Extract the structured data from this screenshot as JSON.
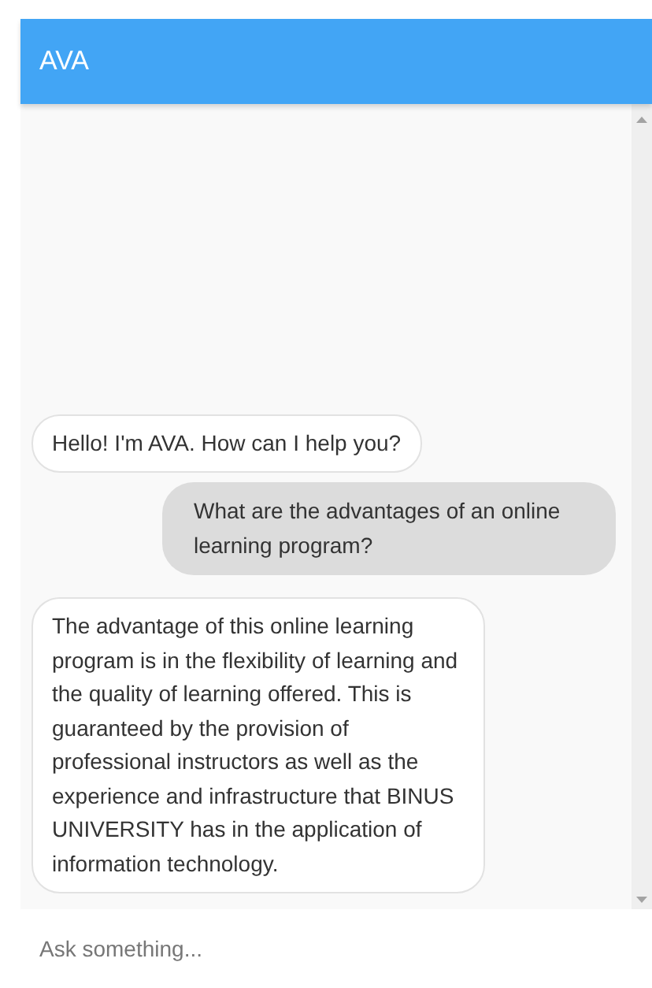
{
  "header": {
    "title": "AVA"
  },
  "messages": [
    {
      "kind": "bot",
      "text": "Hello! I'm AVA. How can I help you?"
    },
    {
      "kind": "user",
      "text": "What are the advantages of an online learning program?"
    },
    {
      "kind": "bot",
      "text": "The advantage of this online learning program is in the flexibility of learning and the quality of learning offered. This is guaranteed by the provision of professional instructors as well as the experience and infrastructure that BINUS UNIVERSITY has in the application of information technology."
    }
  ],
  "input": {
    "placeholder": "Ask something..."
  }
}
